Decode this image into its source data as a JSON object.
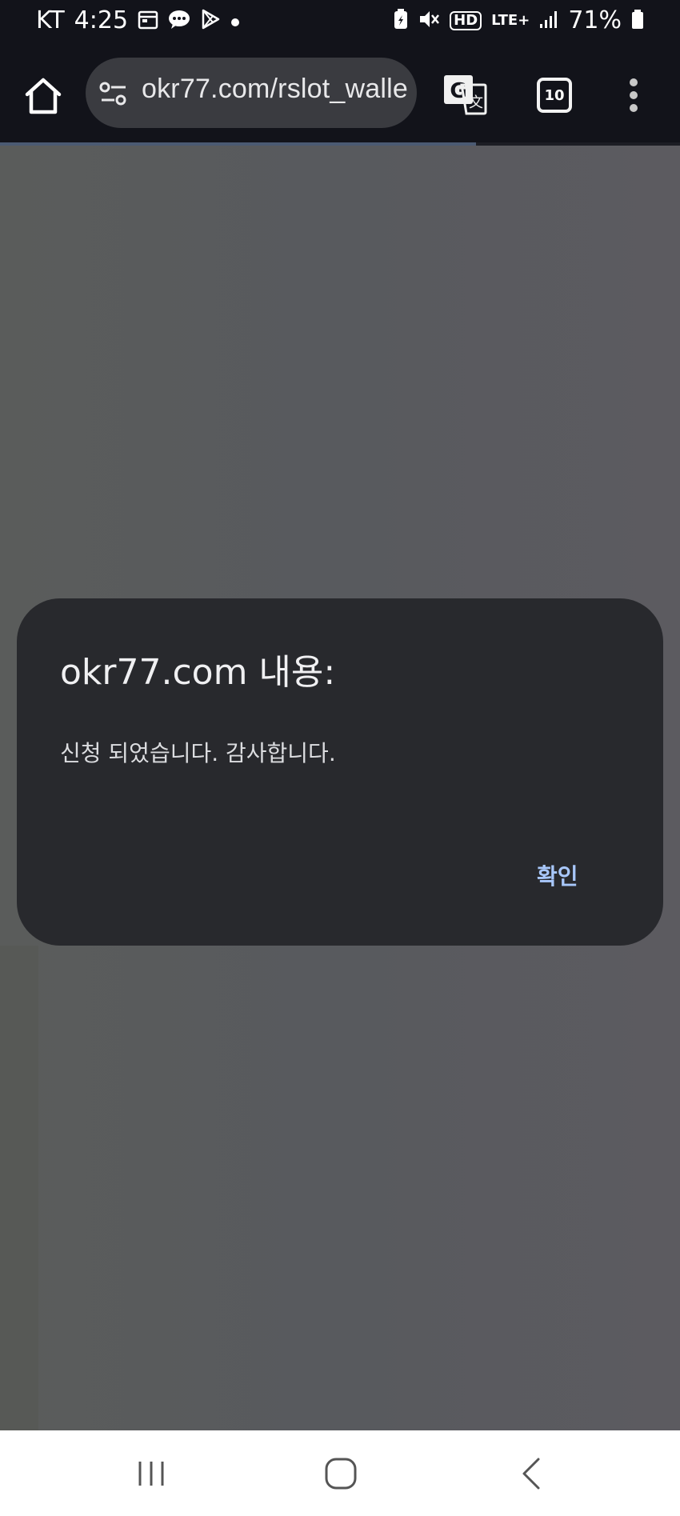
{
  "status_bar": {
    "carrier": "KT",
    "time": "4:25",
    "notification_icons": [
      "calendar-icon",
      "chat-icon",
      "play-store-icon",
      "dot-icon"
    ],
    "network": "LTE+",
    "hd_label": "HD",
    "battery": "71%"
  },
  "browser": {
    "url": "okr77.com/rslot_walle",
    "tab_count": "10",
    "load_progress": 0.7
  },
  "dialog": {
    "title": "okr77.com 내용:",
    "message": "신청 되었습니다. 감사합니다.",
    "confirm_label": "확인"
  },
  "colors": {
    "status_bg": "#12131a",
    "dialog_bg": "#28292d",
    "accent": "#a8c7fa",
    "scrim": "#5b5d5e"
  }
}
